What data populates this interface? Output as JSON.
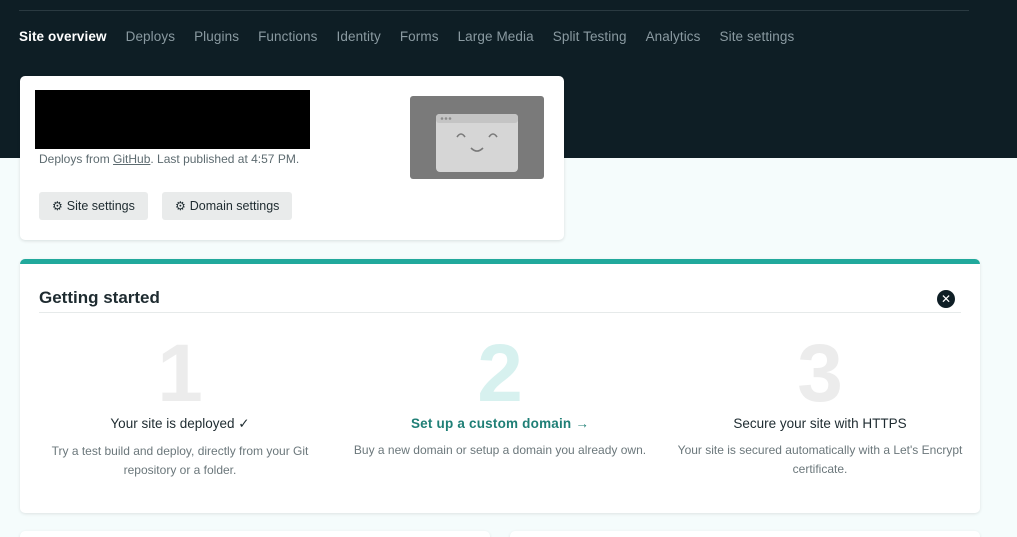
{
  "nav": {
    "items": [
      {
        "label": "Site overview",
        "active": true
      },
      {
        "label": "Deploys"
      },
      {
        "label": "Plugins"
      },
      {
        "label": "Functions"
      },
      {
        "label": "Identity"
      },
      {
        "label": "Forms"
      },
      {
        "label": "Large Media"
      },
      {
        "label": "Split Testing"
      },
      {
        "label": "Analytics"
      },
      {
        "label": "Site settings"
      }
    ]
  },
  "site_card": {
    "deploy_prefix": "Deploys from ",
    "deploy_source": "GitHub",
    "deploy_suffix": ". Last published at 4:57 PM.",
    "site_settings_label": "Site settings",
    "domain_settings_label": "Domain settings"
  },
  "getting_started": {
    "title": "Getting started",
    "steps": [
      {
        "number": "1",
        "heading": "Your site is deployed ✓",
        "description": "Try a test build and deploy, directly from your Git repository or a folder."
      },
      {
        "number": "2",
        "heading": "Set up a custom domain →",
        "description": "Buy a new domain or setup a domain you already own."
      },
      {
        "number": "3",
        "heading": "Secure your site with HTTPS",
        "description": "Your site is secured automatically with a Let's Encrypt certificate."
      }
    ]
  },
  "colors": {
    "header_bg": "#0e1e25",
    "accent": "#21a99c",
    "link": "#1f7f76"
  },
  "icons": {
    "settings": "gear-icon",
    "close": "close-circle-icon",
    "preview": "browser-smiley-icon"
  }
}
